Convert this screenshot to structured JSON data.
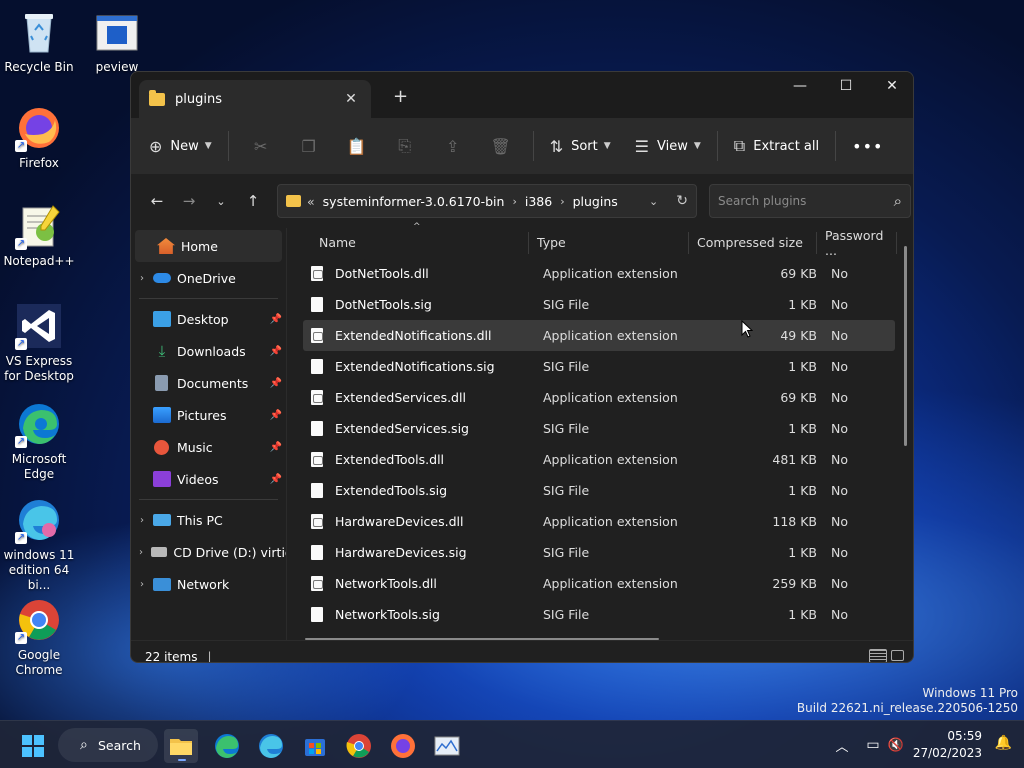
{
  "desktop": {
    "icons": [
      {
        "label": "Recycle Bin",
        "icon": "recycle-bin-icon"
      },
      {
        "label": "peview",
        "icon": "peview-icon"
      },
      {
        "label": "Firefox",
        "icon": "firefox-icon"
      },
      {
        "label": "Notepad++",
        "icon": "notepadpp-icon"
      },
      {
        "label": "VS Express for Desktop",
        "icon": "vs-express-icon"
      },
      {
        "label": "Microsoft Edge",
        "icon": "edge-icon"
      },
      {
        "label": "windows 11 edition 64 bi...",
        "icon": "edge-beta-icon"
      },
      {
        "label": "Google Chrome",
        "icon": "chrome-icon"
      }
    ],
    "watermark": {
      "line1": "Windows 11 Pro",
      "line2": "Build 22621.ni_release.220506-1250"
    }
  },
  "window": {
    "tab_title": "plugins",
    "toolbar": {
      "new_label": "New",
      "sort_label": "Sort",
      "view_label": "View",
      "extract_label": "Extract all"
    },
    "address": {
      "crumbs": [
        "systeminformer-3.0.6170-bin",
        "i386",
        "plugins"
      ],
      "search_placeholder": "Search plugins"
    },
    "nav": {
      "home": "Home",
      "onedrive": "OneDrive",
      "desktop": "Desktop",
      "downloads": "Downloads",
      "documents": "Documents",
      "pictures": "Pictures",
      "music": "Music",
      "videos": "Videos",
      "thispc": "This PC",
      "cddrive": "CD Drive (D:) virtio-",
      "network": "Network"
    },
    "columns": {
      "name": "Name",
      "type": "Type",
      "size": "Compressed size",
      "password": "Password ..."
    },
    "files": [
      {
        "name": "DotNetTools.dll",
        "type": "Application extension",
        "size": "69 KB",
        "password": "No"
      },
      {
        "name": "DotNetTools.sig",
        "type": "SIG File",
        "size": "1 KB",
        "password": "No"
      },
      {
        "name": "ExtendedNotifications.dll",
        "type": "Application extension",
        "size": "49 KB",
        "password": "No"
      },
      {
        "name": "ExtendedNotifications.sig",
        "type": "SIG File",
        "size": "1 KB",
        "password": "No"
      },
      {
        "name": "ExtendedServices.dll",
        "type": "Application extension",
        "size": "69 KB",
        "password": "No"
      },
      {
        "name": "ExtendedServices.sig",
        "type": "SIG File",
        "size": "1 KB",
        "password": "No"
      },
      {
        "name": "ExtendedTools.dll",
        "type": "Application extension",
        "size": "481 KB",
        "password": "No"
      },
      {
        "name": "ExtendedTools.sig",
        "type": "SIG File",
        "size": "1 KB",
        "password": "No"
      },
      {
        "name": "HardwareDevices.dll",
        "type": "Application extension",
        "size": "118 KB",
        "password": "No"
      },
      {
        "name": "HardwareDevices.sig",
        "type": "SIG File",
        "size": "1 KB",
        "password": "No"
      },
      {
        "name": "NetworkTools.dll",
        "type": "Application extension",
        "size": "259 KB",
        "password": "No"
      },
      {
        "name": "NetworkTools.sig",
        "type": "SIG File",
        "size": "1 KB",
        "password": "No"
      }
    ],
    "status": "22 items"
  },
  "taskbar": {
    "search_label": "Search",
    "time": "05:59",
    "date": "27/02/2023"
  }
}
